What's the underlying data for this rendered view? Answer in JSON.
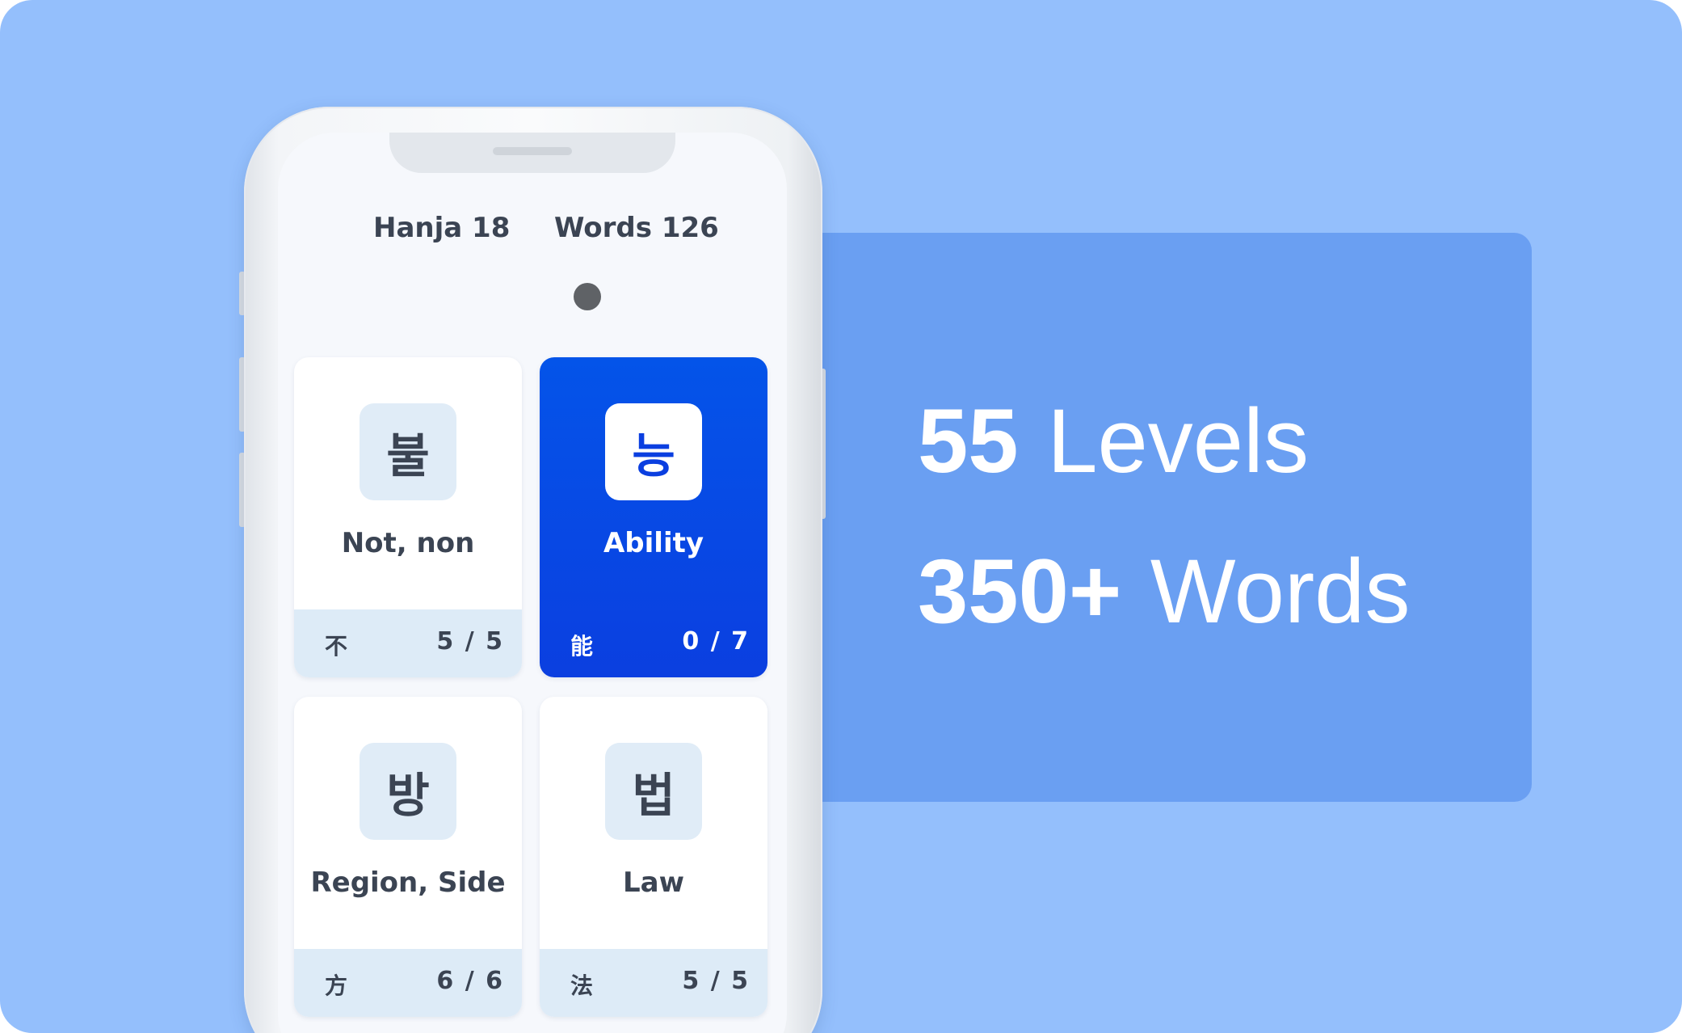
{
  "promo": {
    "line1_number": "55",
    "line1_word": "Levels",
    "line2_number": "350+",
    "line2_word": "Words"
  },
  "tabs": {
    "hanja": "Hanja 18",
    "words": "Words 126"
  },
  "cards": [
    {
      "character": "불",
      "meaning": "Not, non",
      "hanja": "不",
      "progress": "5 / 5",
      "active": false
    },
    {
      "character": "능",
      "meaning": "Ability",
      "hanja": "能",
      "progress": "0 / 7",
      "active": true
    },
    {
      "character": "방",
      "meaning": "Region, Side",
      "hanja": "方",
      "progress": "6 / 6",
      "active": false
    },
    {
      "character": "법",
      "meaning": "Law",
      "hanja": "法",
      "progress": "5 / 5",
      "active": false
    }
  ],
  "colors": {
    "background": "#94bffc",
    "panel": "#6a9ff2",
    "active_card": "#0b3fe0",
    "text_dark": "#3b4453"
  }
}
